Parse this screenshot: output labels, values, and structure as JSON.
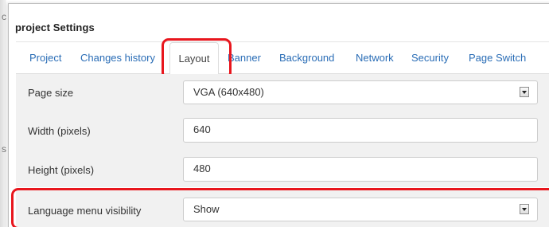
{
  "dialog": {
    "title": "project Settings"
  },
  "tabs": [
    {
      "label": "Project",
      "active": false
    },
    {
      "label": "Changes history",
      "active": false
    },
    {
      "label": "Layout",
      "active": true
    },
    {
      "label": "Banner",
      "active": false
    },
    {
      "label": "Background",
      "active": false
    },
    {
      "label": "Network",
      "active": false
    },
    {
      "label": "Security",
      "active": false
    },
    {
      "label": "Page Switch",
      "active": false
    }
  ],
  "form": {
    "page_size": {
      "label": "Page size",
      "value": "VGA (640x480)"
    },
    "width": {
      "label": "Width (pixels)",
      "value": "640"
    },
    "height": {
      "label": "Height (pixels)",
      "value": "480"
    },
    "language_menu": {
      "label": "Language menu visibility",
      "value": "Show"
    }
  },
  "colors": {
    "tab_link": "#2a6db6",
    "highlight": "#e8161d",
    "row_background": "#f1f1f1"
  }
}
